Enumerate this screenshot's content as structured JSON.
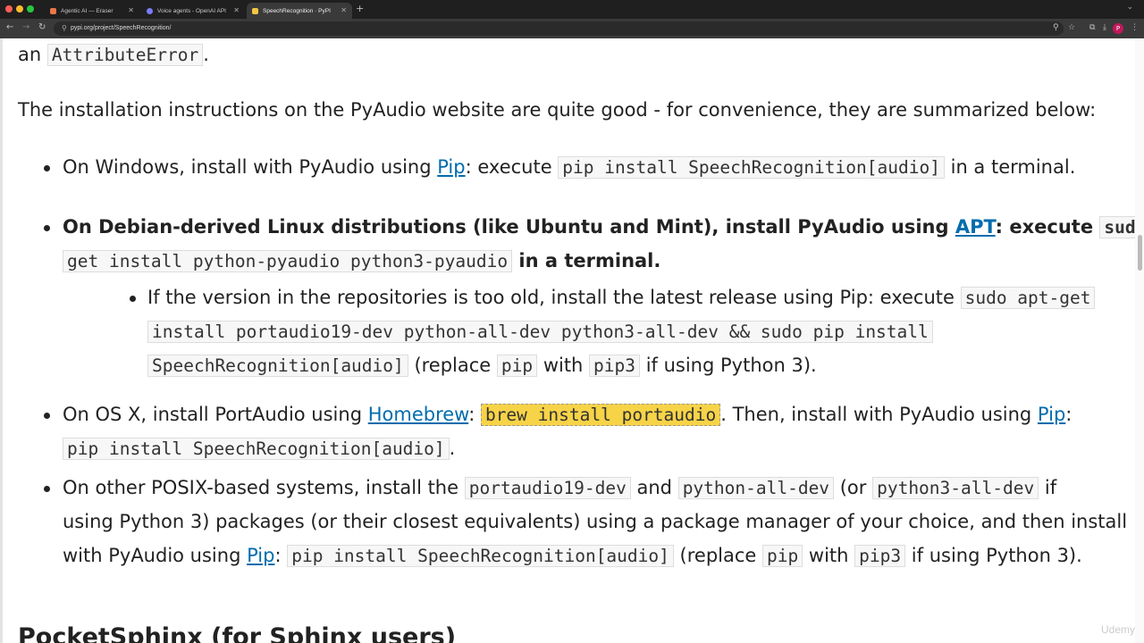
{
  "browser": {
    "tabs": [
      {
        "label": "Agentic AI — Eraser",
        "favicon_color": "#e8774a"
      },
      {
        "label": "Voice agents - OpenAI API",
        "favicon_color": "#7b7bff"
      },
      {
        "label": "SpeechRecognition · PyPI",
        "favicon_color": "#f4c542"
      }
    ],
    "new_tab": "+",
    "url": "pypi.org/project/SpeechRecognition/"
  },
  "content": {
    "intro_end": {
      "prefix": "an",
      "code": "AttributeError",
      "suffix": "."
    },
    "intro": "The installation instructions on the PyAudio website are quite good - for convenience, they are summarized below:",
    "windows": {
      "t1": "On Windows, install with PyAudio using ",
      "link": "Pip",
      "t2": ": execute ",
      "code": "pip install SpeechRecognition[audio]",
      "t3": " in a terminal."
    },
    "debian": {
      "t1": "On Debian-derived Linux distributions (like Ubuntu and Mint), install PyAudio using ",
      "link": "APT",
      "t2": ": execute ",
      "code1": "sudo apt-",
      "code2": "get install python-pyaudio python3-pyaudio",
      "t3": " in a terminal."
    },
    "debian_sub": {
      "t1": "If the version in the repositories is too old, install the latest release using Pip: execute ",
      "code1": "sudo apt-get",
      "code2": "install portaudio19-dev python-all-dev python3-all-dev && sudo pip install",
      "code3": "SpeechRecognition[audio]",
      "t2": " (replace ",
      "code4": "pip",
      "t3": " with ",
      "code5": "pip3",
      "t4": " if using Python 3)."
    },
    "osx": {
      "t1": "On OS X, install PortAudio using ",
      "link1": "Homebrew",
      "t2": ": ",
      "code1": "brew install portaudio",
      "t3": ". Then, install with PyAudio using ",
      "link2": "Pip",
      "t4": ":",
      "code2": "pip install SpeechRecognition[audio]",
      "t5": "."
    },
    "posix": {
      "t1": "On other POSIX-based systems, install the ",
      "code1": "portaudio19-dev",
      "t2": " and ",
      "code2": "python-all-dev",
      "t3": " (or ",
      "code3": "python3-all-dev",
      "t4": " if",
      "line2": "using Python 3) packages (or their closest equivalents) using a package manager of your choice, and then install",
      "t5": "with PyAudio using ",
      "link": "Pip",
      "t6": ": ",
      "code4": "pip install SpeechRecognition[audio]",
      "t7": " (replace ",
      "code5": "pip",
      "t8": " with ",
      "code6": "pip3",
      "t9": " if using Python 3)."
    },
    "next_heading": "PocketSphinx (for Sphinx users)"
  },
  "watermark": "Udemy"
}
